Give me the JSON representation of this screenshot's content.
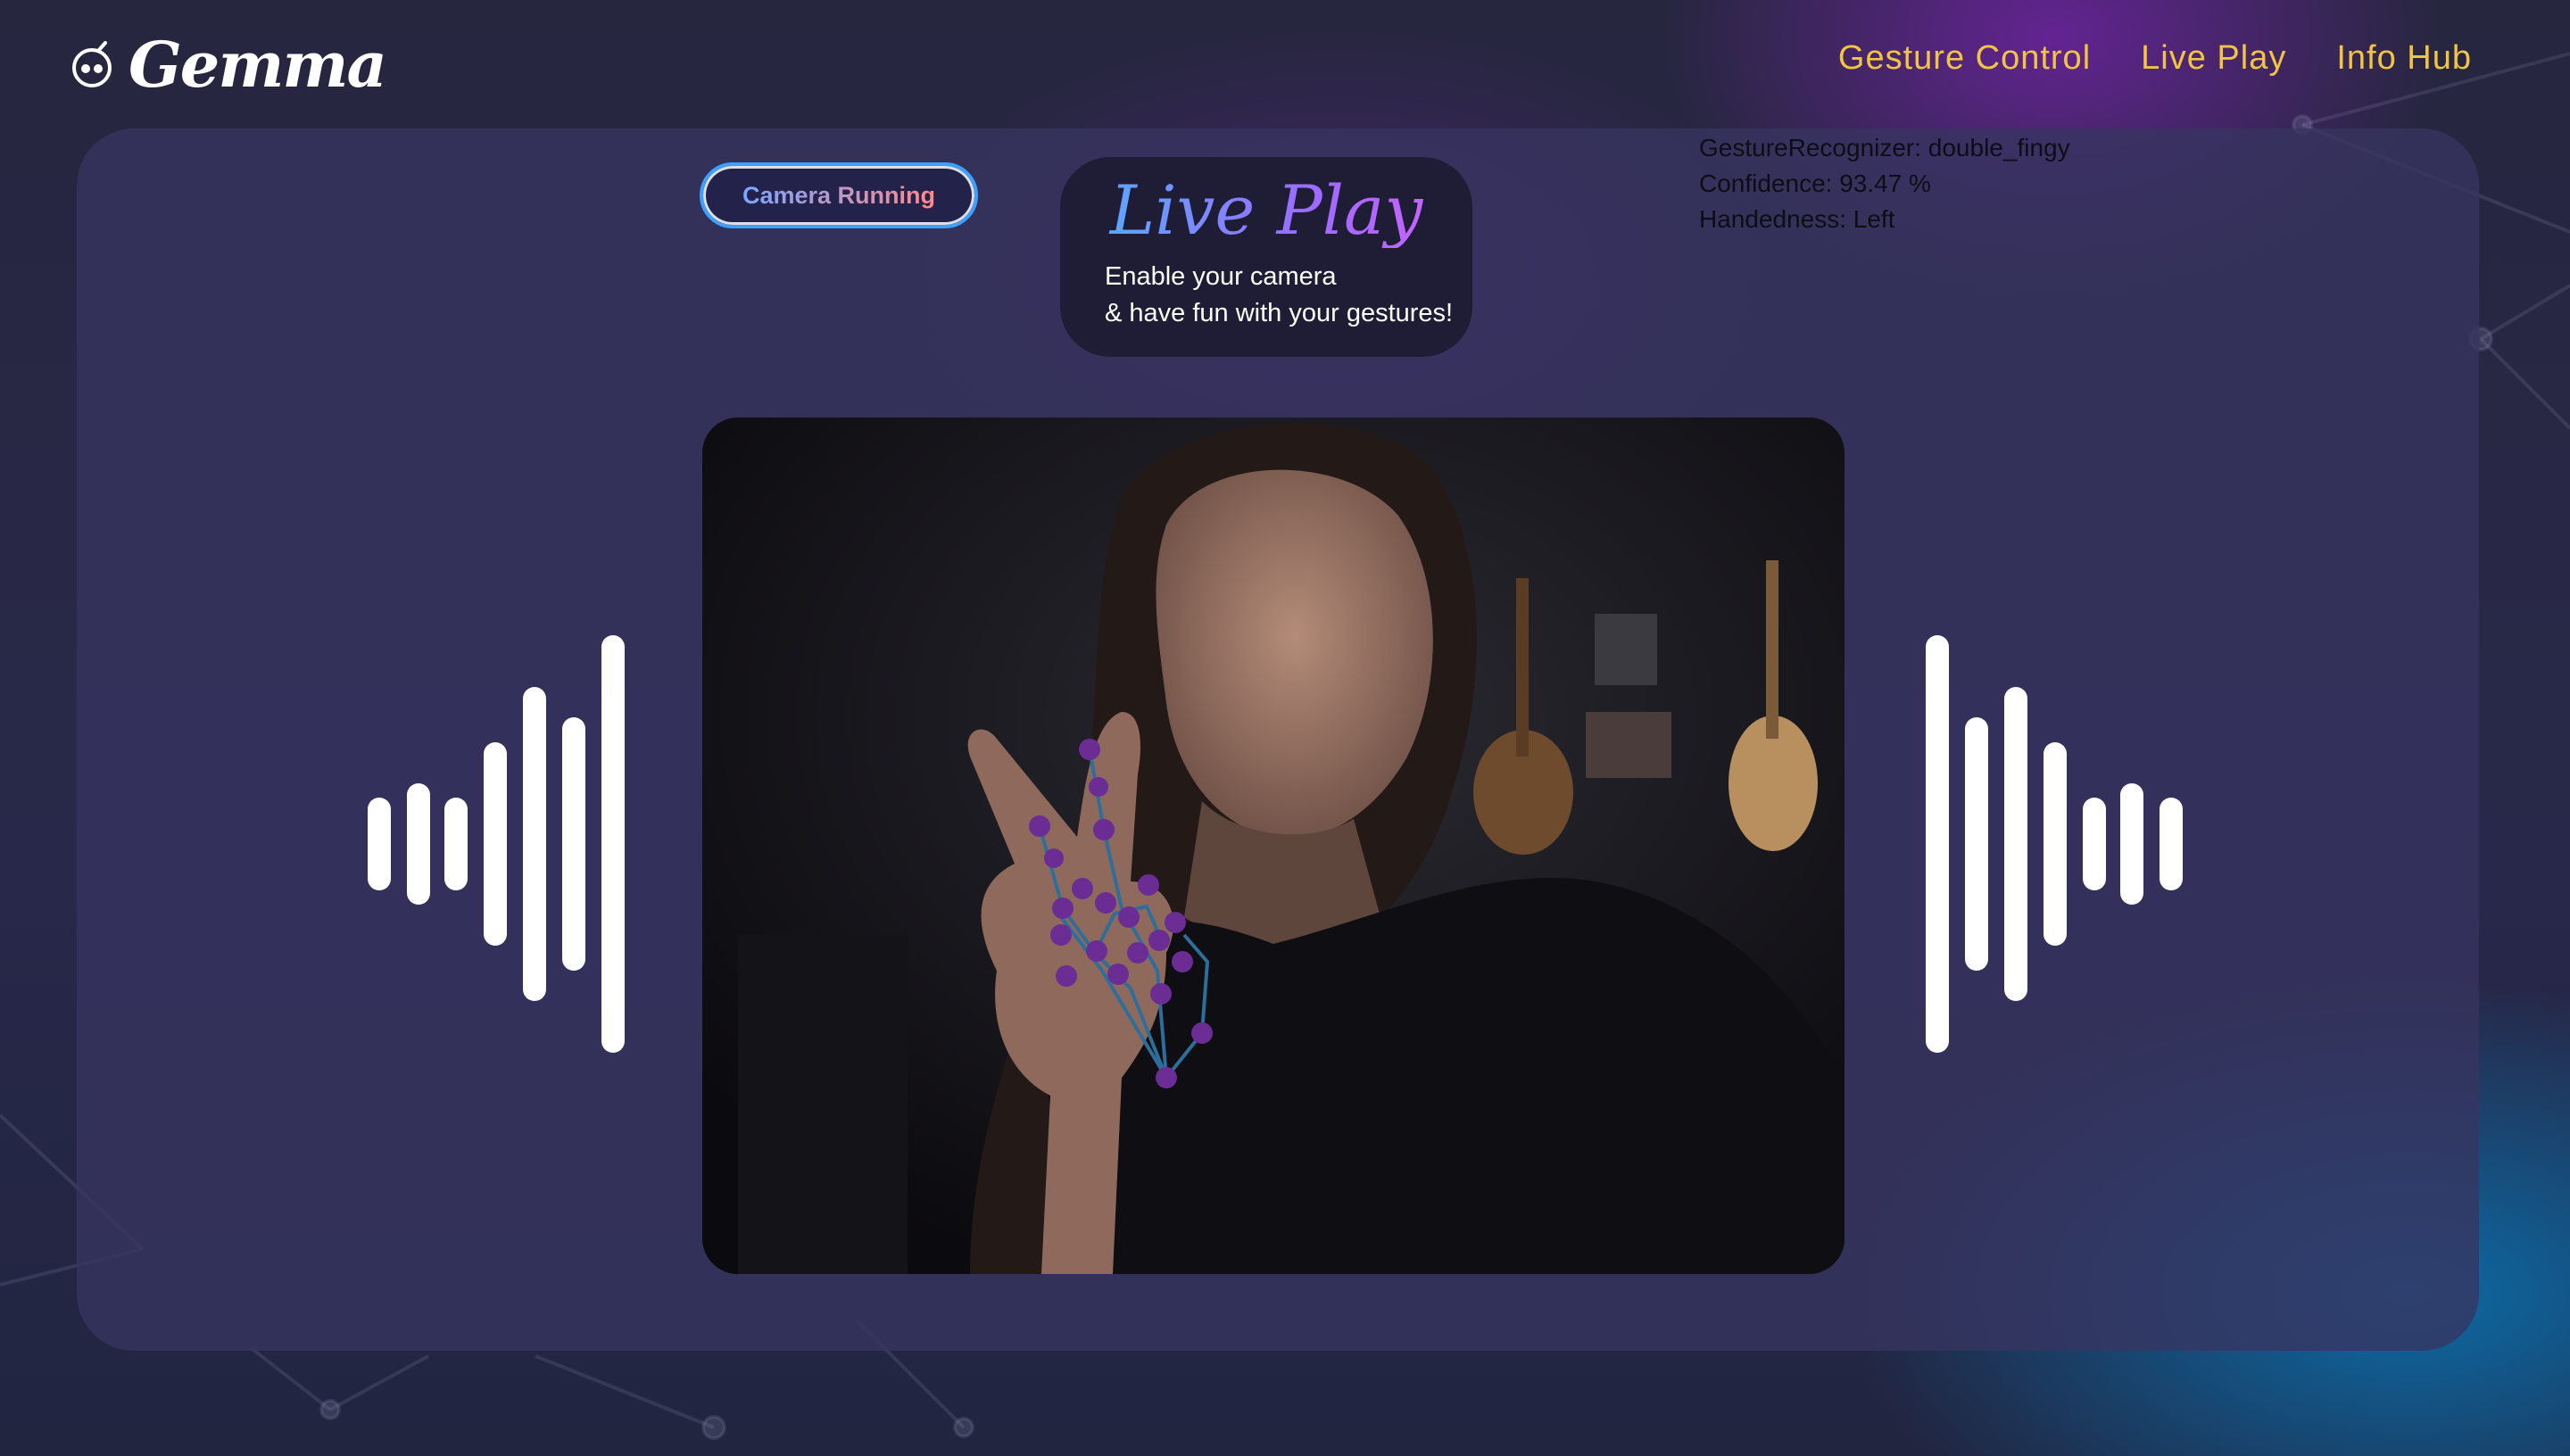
{
  "app": {
    "logo_text": "Gemma",
    "logo_icon": "robot-face-icon"
  },
  "nav": {
    "items": [
      {
        "label": "Gesture Control"
      },
      {
        "label": "Live Play"
      },
      {
        "label": "Info Hub"
      }
    ]
  },
  "camera_button": {
    "label": "Camera Running"
  },
  "title_card": {
    "title": "Live Play",
    "line1": "Enable your camera",
    "line2": "& have fun with your gestures!"
  },
  "status": {
    "gesture": "GestureRecognizer: double_fingy",
    "confidence": "Confidence: 93.47 %",
    "handedness": "Handedness: Left"
  },
  "video": {
    "content": "webcam-feed",
    "overlay": "hand-landmarks",
    "landmark_color": "#6b2c94",
    "connector_color": "#2d6e9a"
  },
  "colors": {
    "nav": "#f2c445",
    "accent_purple": "#6e24a0",
    "accent_blue": "#0b6eaa"
  }
}
